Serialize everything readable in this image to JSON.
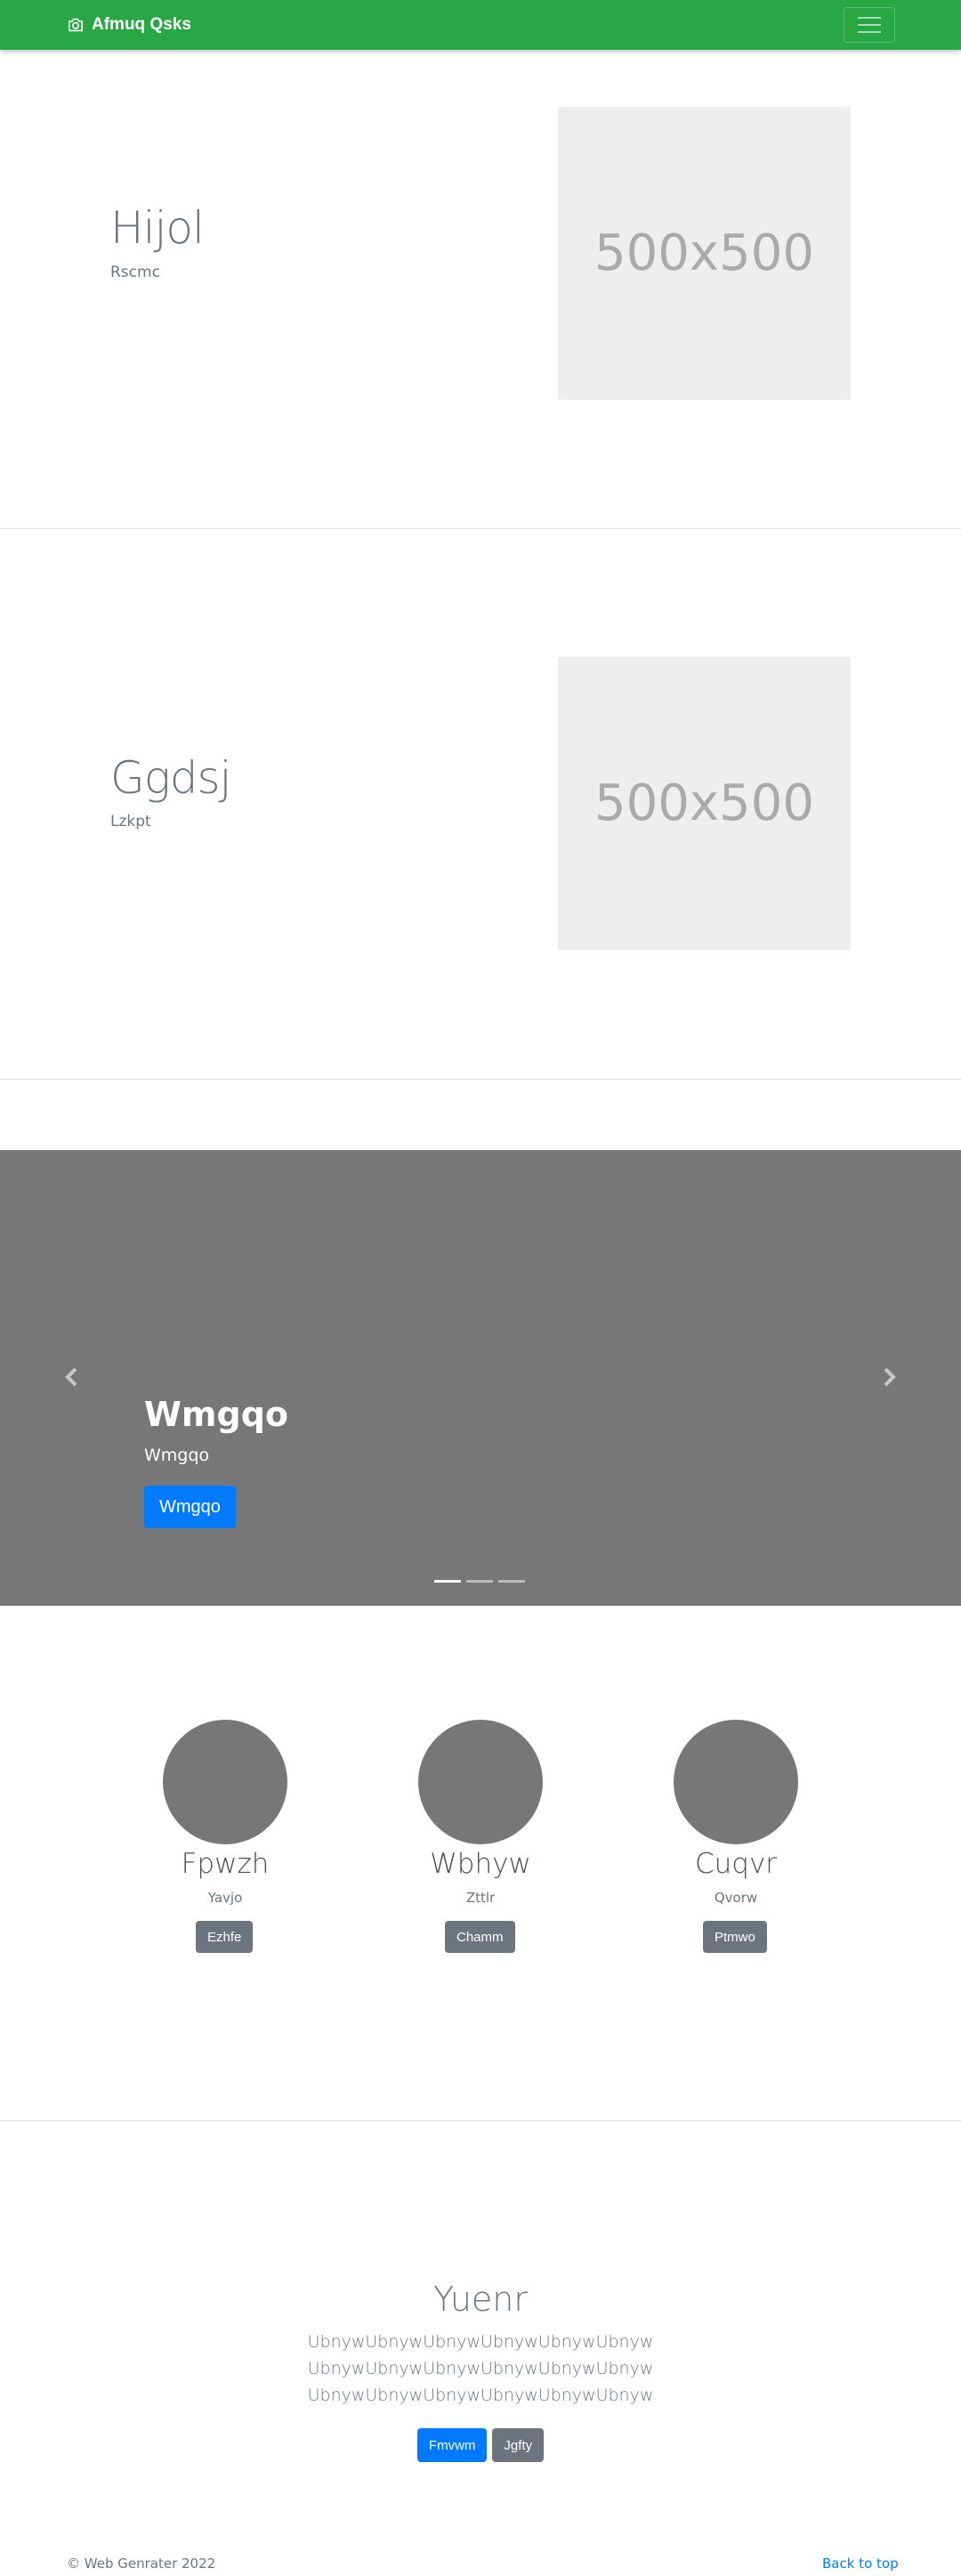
{
  "navbar": {
    "brand": "Afmuq Qsks",
    "brand_icon": "camera-icon",
    "toggler_icon": "hamburger-menu-icon",
    "bg_color": "#28a745"
  },
  "features": [
    {
      "heading": "Hijol",
      "subheading": "Rscmc",
      "image_label": "500x500"
    },
    {
      "heading": "Ggdsj",
      "subheading": "Lzkpt",
      "image_label": "500x500"
    }
  ],
  "carousel": {
    "title": "Wmgqo",
    "text": "Wmgqo",
    "button": "Wmgqo",
    "prev_icon": "chevron-left-icon",
    "next_icon": "chevron-right-icon",
    "indicator_count": 3,
    "active_indicator": 1
  },
  "team": [
    {
      "name": "Fpwzh",
      "role": "Yavjo",
      "button": "Ezhfe"
    },
    {
      "name": "Wbhyw",
      "role": "Zttlr",
      "button": "Chamm"
    },
    {
      "name": "Cuqvr",
      "role": "Qvorw",
      "button": "Ptmwo"
    }
  ],
  "jumbotron": {
    "title": "Yuenr",
    "lines": [
      "UbnywUbnywUbnywUbnywUbnywUbnyw",
      "UbnywUbnywUbnywUbnywUbnywUbnyw",
      "UbnywUbnywUbnywUbnywUbnywUbnyw"
    ],
    "primary_button": "Fmvwm",
    "secondary_button": "Jgfty"
  },
  "footer": {
    "copyright": "© Web Genrater 2022",
    "back_to_top": "Back to top"
  }
}
